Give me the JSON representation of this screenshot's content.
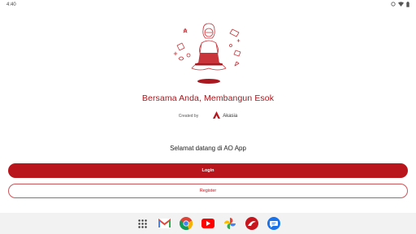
{
  "status_bar": {
    "time": "4:40",
    "icons": [
      "circle-status-icon",
      "wifi-icon",
      "battery-icon"
    ]
  },
  "hero": {
    "illustration": "person-with-laptop-illustration",
    "tagline": "Bersama Anda, Membangun Esok",
    "created_by": "Created by",
    "brand_name": "Akasia",
    "brand_color": "#b8151c"
  },
  "welcome": {
    "text": "Selamat datang di AO App"
  },
  "actions": {
    "login_label": "Login",
    "register_label": "Register"
  },
  "taskbar": {
    "apps": [
      "app-drawer-icon",
      "gmail-icon",
      "chrome-icon",
      "youtube-icon",
      "photos-icon",
      "ao-app-icon",
      "messages-icon"
    ]
  }
}
